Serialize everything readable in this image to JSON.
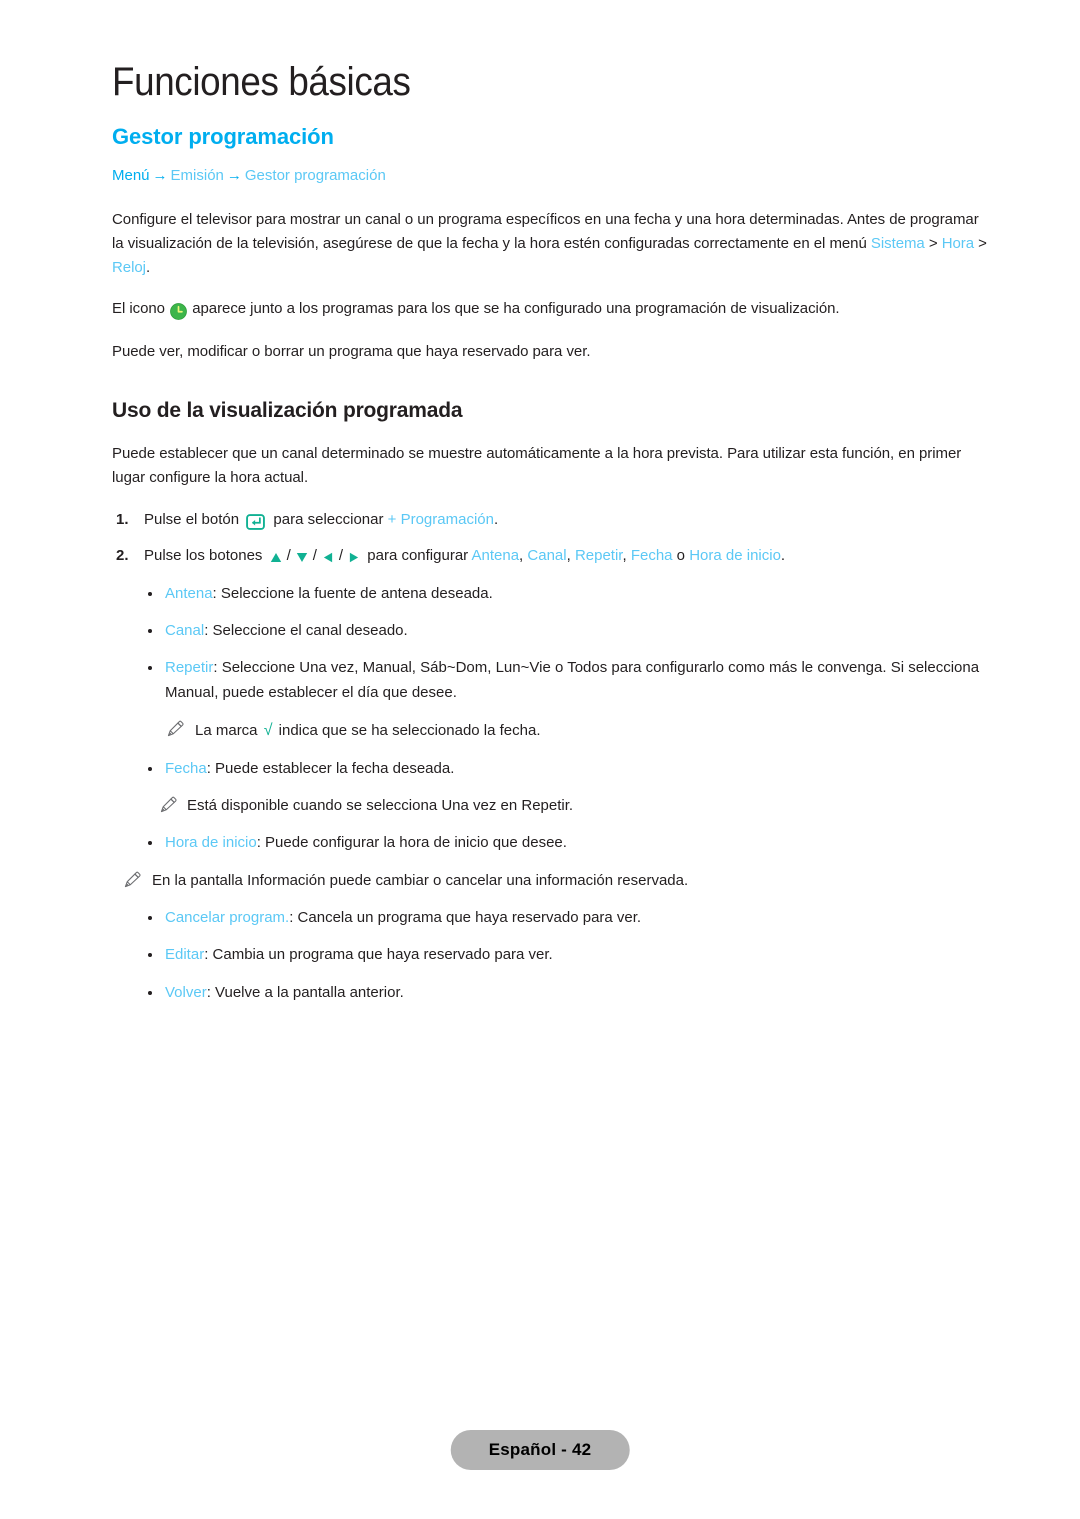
{
  "page": {
    "chapter_title": "Funciones básicas",
    "section_heading": "Gestor programación",
    "footer_label": "Español - 42"
  },
  "breadcrumb": {
    "first": "Menú",
    "arrow": "→",
    "second": "Emisión",
    "third": "Gestor programación"
  },
  "intro": {
    "paragraph_1_part1": "Configure el televisor para mostrar un canal o un programa específicos en una fecha y una hora determinadas. Antes de programar la visualización de la televisión, asegúrese de que la fecha y la hora estén configuradas correctamente en el menú ",
    "menu_sistema": "Sistema",
    "sep1": " > ",
    "menu_hora": "Hora",
    "sep2": " > ",
    "menu_reloj": "Reloj",
    "period": ".",
    "paragraph_2_part1": "El icono ",
    "paragraph_2_part2": " aparece junto a los programas para los que se ha configurado una programación de visualización.",
    "paragraph_3": "Puede ver, modificar o borrar un programa que haya reservado para ver."
  },
  "usage": {
    "heading": "Uso de la visualización programada",
    "intro": "Puede establecer que un canal determinado se muestre automáticamente a la hora prevista. Para utilizar esta función, en primer lugar configure la hora actual.",
    "step1": {
      "number": "1.",
      "text_before": "Pulse el botón ",
      "text_middle": " para seleccionar  ",
      "link": "+ Programación",
      "text_after": "."
    },
    "step2": {
      "number": "2.",
      "text_before": "Pulse los botones ",
      "text_middle": " para configurar ",
      "opt1": "Antena",
      "comma1": ", ",
      "opt2": "Canal",
      "comma2": ", ",
      "opt3": "Repetir",
      "comma3": ", ",
      "opt4": "Fecha",
      "conj": " o ",
      "opt5": "Hora de inicio",
      "text_after": "."
    }
  },
  "options": [
    {
      "term": "Antena",
      "desc": ": Seleccione la fuente de antena deseada."
    },
    {
      "term": "Canal",
      "desc": ": Seleccione el canal deseado."
    },
    {
      "term": "Repetir",
      "desc": ": Seleccione Una vez, Manual, Sáb~Dom, Lun~Vie o Todos para configurarlo como más le convenga. Si selecciona Manual, puede establecer el día que desee."
    },
    {
      "term": "Fecha",
      "desc": ": Puede establecer la fecha deseada."
    },
    {
      "term": "Hora de inicio",
      "desc": ": Puede configurar la hora de inicio que desee."
    },
    {
      "term": "Cancelar program.",
      "desc": ": Cancela un programa que haya reservado para ver."
    },
    {
      "term": "Editar",
      "desc": ": Cambia un programa que haya reservado para ver."
    },
    {
      "term": "Volver",
      "desc": ": Vuelve a la pantalla anterior."
    }
  ],
  "notes": {
    "note_repeat_before": "La marca ",
    "note_repeat_check": "√",
    "note_repeat_after": " indica que se ha seleccionado la fecha.",
    "note_fecha": "Está disponible cuando se selecciona Una vez en Repetir.",
    "note_info": "En la pantalla Información puede cambiar o cancelar una información reservada."
  },
  "icons": {
    "clock": "clock-icon",
    "enter": "enter-button-icon",
    "arrow_up": "arrow-up-icon",
    "arrow_down": "arrow-down-icon",
    "arrow_left": "arrow-left-icon",
    "arrow_right": "arrow-right-icon",
    "pencil": "pencil-note-icon"
  },
  "colors": {
    "accent_cyan": "#00aeef",
    "link_cyan": "#5bc8f5",
    "teal": "#10b193",
    "green_icon": "#3cb54a",
    "footer_grey": "#b3b3b3",
    "text": "#231f20"
  }
}
